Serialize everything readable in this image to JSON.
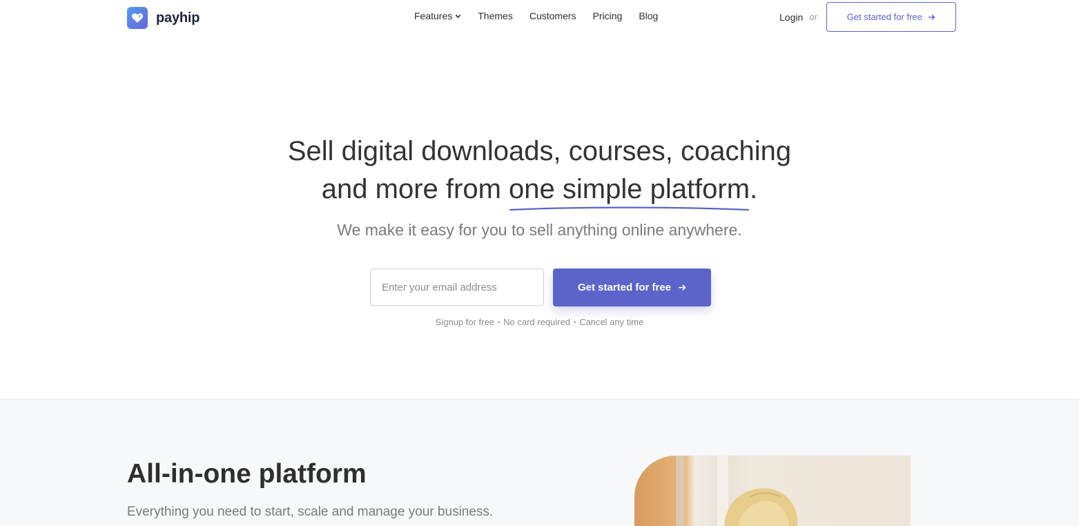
{
  "brand": {
    "name": "payhip",
    "accent": "#5b64c9"
  },
  "nav": {
    "items": [
      {
        "label": "Features",
        "has_dropdown": true
      },
      {
        "label": "Themes"
      },
      {
        "label": "Customers"
      },
      {
        "label": "Pricing"
      },
      {
        "label": "Blog"
      }
    ],
    "login": "Login",
    "or": "or",
    "cta": "Get started for free"
  },
  "hero": {
    "title_line1": "Sell digital downloads, courses, coaching",
    "title_line2_prefix": "and more from ",
    "title_line2_highlight": "one simple platform",
    "title_line2_suffix": ".",
    "subtitle": "We make it easy for you to sell anything online anywhere.",
    "email_placeholder": "Enter your email address",
    "cta": "Get started for free",
    "fineprint": [
      "Signup for free",
      "No card required",
      "Cancel any time"
    ]
  },
  "section2": {
    "title": "All-in-one platform",
    "subtitle": "Everything you need to start, scale and manage your business."
  }
}
